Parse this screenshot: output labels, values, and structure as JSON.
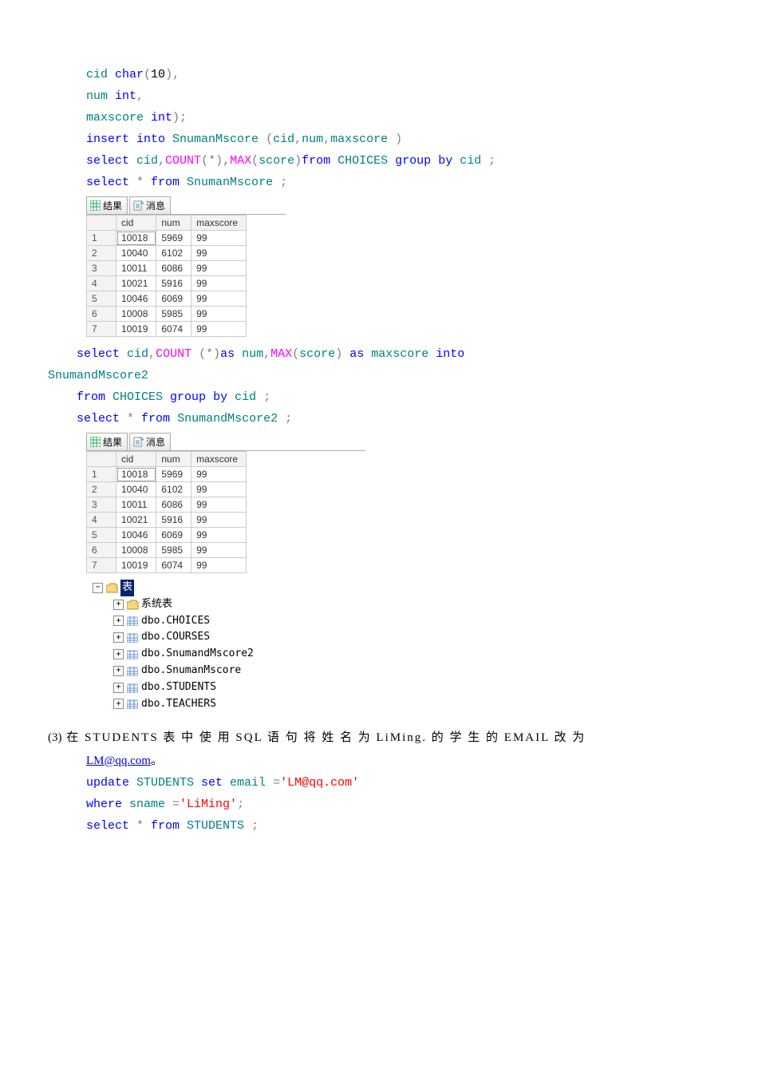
{
  "code1": {
    "l1_a": "cid ",
    "l1_b": "char",
    "l1_c": "(",
    "l1_d": "10",
    "l1_e": "),",
    "l2_a": "num ",
    "l2_b": "int",
    "l2_c": ",",
    "l3_a": "maxscore ",
    "l3_b": "int",
    "l3_c": ");",
    "l4_a": "insert",
    "l4_b": " into",
    "l4_c": " SnumanMscore ",
    "l4_d": "(",
    "l4_e": "cid",
    "l4_f": ",",
    "l4_g": "num",
    "l4_h": ",",
    "l4_i": "maxscore ",
    "l4_j": ")",
    "l5_a": "select",
    "l5_b": " cid",
    "l5_c": ",",
    "l5_d": "COUNT",
    "l5_e": "(*),",
    "l5_f": "MAX",
    "l5_g": "(",
    "l5_h": "score",
    "l5_i": ")",
    "l5_j": "from",
    "l5_k": " CHOICES ",
    "l5_l": "group",
    "l5_m": " by",
    "l5_n": " cid ",
    "l5_o": ";",
    "l6_a": "select",
    "l6_b": " *",
    "l6_c": " from",
    "l6_d": " SnumanMscore ",
    "l6_e": ";"
  },
  "tabs": {
    "results": "结果",
    "messages": "消息"
  },
  "gridHeaders": {
    "c1": "cid",
    "c2": "num",
    "c3": "maxscore"
  },
  "chart_data": [
    {
      "type": "table",
      "title": "SnumanMscore",
      "columns": [
        "cid",
        "num",
        "maxscore"
      ],
      "rows": [
        [
          "10018",
          "5969",
          "99"
        ],
        [
          "10040",
          "6102",
          "99"
        ],
        [
          "10011",
          "6086",
          "99"
        ],
        [
          "10021",
          "5916",
          "99"
        ],
        [
          "10046",
          "6069",
          "99"
        ],
        [
          "10008",
          "5985",
          "99"
        ],
        [
          "10019",
          "6074",
          "99"
        ]
      ]
    },
    {
      "type": "table",
      "title": "SnumandMscore2",
      "columns": [
        "cid",
        "num",
        "maxscore"
      ],
      "rows": [
        [
          "10018",
          "5969",
          "99"
        ],
        [
          "10040",
          "6102",
          "99"
        ],
        [
          "10011",
          "6086",
          "99"
        ],
        [
          "10021",
          "5916",
          "99"
        ],
        [
          "10046",
          "6069",
          "99"
        ],
        [
          "10008",
          "5985",
          "99"
        ],
        [
          "10019",
          "6074",
          "99"
        ]
      ]
    }
  ],
  "code2": {
    "l1_pre": "    ",
    "l1_a": "select",
    "l1_b": " cid",
    "l1_c": ",",
    "l1_d": "COUNT ",
    "l1_e": "(*)",
    "l1_f": "as",
    "l1_g": " num",
    "l1_h": ",",
    "l1_i": "MAX",
    "l1_j": "(",
    "l1_k": "score",
    "l1_l": ")",
    "l1_m": " as",
    "l1_n": " maxscore ",
    "l1_o": "into",
    "l2": "SnumandMscore2",
    "l3_pre": "    ",
    "l3_a": "from",
    "l3_b": " CHOICES ",
    "l3_c": "group",
    "l3_d": " by",
    "l3_e": " cid ",
    "l3_f": ";",
    "l4_pre": "    ",
    "l4_a": "select",
    "l4_b": " *",
    "l4_c": " from",
    "l4_d": " SnumandMscore2 ",
    "l4_e": ";"
  },
  "tree": {
    "root": "表",
    "n1": "系统表",
    "n2": "dbo.CHOICES",
    "n3": "dbo.COURSES",
    "n4": "dbo.SnumandMscore2",
    "n5": "dbo.SnumanMscore",
    "n6": "dbo.STUDENTS",
    "n7": "dbo.TEACHERS"
  },
  "para3": {
    "num": "(3)",
    "t1": " 在 STUDENTS 表 中 使 用 SQL 语 句 将 姓 名 为 LiMing. 的 学 生 的 EMAIL 改 为",
    "link": "LM@qq.com",
    "period": "。"
  },
  "code3": {
    "l1_a": "update",
    "l1_b": " STUDENTS ",
    "l1_c": "set",
    "l1_d": " email ",
    "l1_e": "=",
    "l1_f": "'LM@qq.com'",
    "l2_a": "where",
    "l2_b": " sname ",
    "l2_c": "=",
    "l2_d": "'LiMing'",
    "l2_e": ";",
    "l3_a": "select",
    "l3_b": " *",
    "l3_c": " from",
    "l3_d": " STUDENTS ",
    "l3_e": ";"
  }
}
